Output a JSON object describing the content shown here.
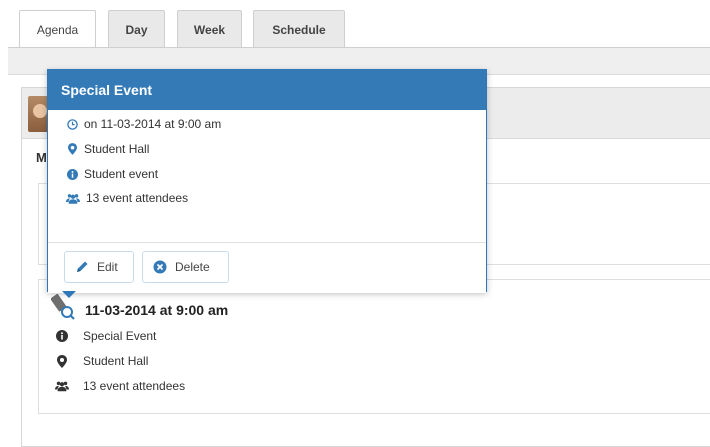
{
  "tabs": [
    {
      "label": "Agenda"
    },
    {
      "label": "Day"
    },
    {
      "label": "Week"
    },
    {
      "label": "Schedule"
    }
  ],
  "agenda": {
    "section_letter": "M",
    "event": {
      "datetime": "11-03-2014 at 9:00 am",
      "title": "Special Event",
      "location": "Student Hall",
      "attendees": "13 event attendees"
    }
  },
  "popover": {
    "title": "Special Event",
    "datetime": "on 11-03-2014 at 9:00 am",
    "location": "Student Hall",
    "category": "Student event",
    "attendees": "13 event attendees",
    "edit_label": "Edit",
    "delete_label": "Delete"
  },
  "colors": {
    "header_blue": "#337ab7",
    "icon_blue": "#337ab7",
    "icon_dark": "#333333"
  }
}
